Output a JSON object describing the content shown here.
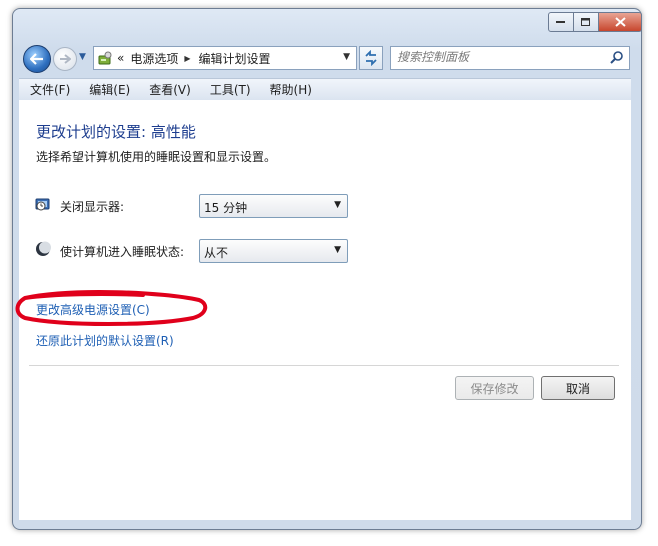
{
  "address": {
    "breadcrumbs": [
      "电源选项",
      "编辑计划设置"
    ],
    "chevrons": "«",
    "folder_icon": "power-options-icon"
  },
  "search": {
    "placeholder": "搜索控制面板"
  },
  "menu": [
    "文件(F)",
    "编辑(E)",
    "查看(V)",
    "工具(T)",
    "帮助(H)"
  ],
  "plan": {
    "title": "更改计划的设置: 高性能",
    "description": "选择希望计算机使用的睡眠设置和显示设置。"
  },
  "settings": {
    "display_off": {
      "label": "关闭显示器:",
      "value": "15 分钟",
      "icon": "monitor-clock-icon"
    },
    "sleep": {
      "label": "使计算机进入睡眠状态:",
      "value": "从不",
      "icon": "moon-icon"
    }
  },
  "links": {
    "advanced": "更改高级电源设置(C)",
    "restore": "还原此计划的默认设置(R)"
  },
  "buttons": {
    "save": "保存修改",
    "cancel": "取消"
  },
  "colors": {
    "link": "#1e5fb4",
    "title": "#1e3e8f",
    "annotation": "#e0001b"
  }
}
